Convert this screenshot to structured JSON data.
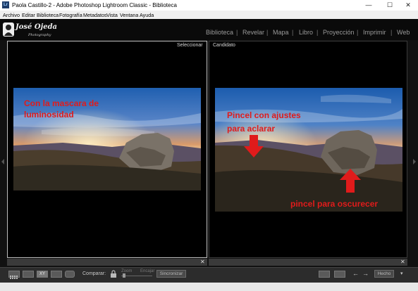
{
  "titlebar": {
    "icon": "Lr",
    "title": "Paola Castillo-2 - Adobe Photoshop Lightroom Classic - Biblioteca",
    "minimize": "—",
    "maximize": "☐",
    "close": "✕"
  },
  "menu": [
    "Archivo",
    "Editar",
    "Biblioteca",
    "Fotografía",
    "Metadatos",
    "Vista",
    "Ventana",
    "Ayuda"
  ],
  "identity": {
    "logo_main": "José Ojeda",
    "logo_sub": "Photography"
  },
  "modules": {
    "items": [
      "Biblioteca",
      "Revelar",
      "Mapa",
      "Libro",
      "Proyección",
      "Imprimir",
      "Web"
    ],
    "active": "Biblioteca"
  },
  "panels": {
    "left_label": "Seleccionar",
    "right_label": "Candidato"
  },
  "annotations": {
    "left_line1": "Con la mascara de",
    "left_line2": "luminosidad",
    "right_line1": "Pincel con ajustes",
    "right_line2": "para aclarar",
    "right_bottom": "pincel para oscurecer",
    "arrow_color": "#e01b1b"
  },
  "strip": {
    "close_glyph": "✕"
  },
  "toolbar": {
    "compare_label": "Comparar:",
    "zoom_label": "Zoom",
    "fit_label": "Encajar",
    "sync_button": "Sincronizar",
    "done_button": "Hecho",
    "xy_label": "XY"
  },
  "colors": {
    "accent_red": "#e01b1b",
    "background": "#000000"
  }
}
